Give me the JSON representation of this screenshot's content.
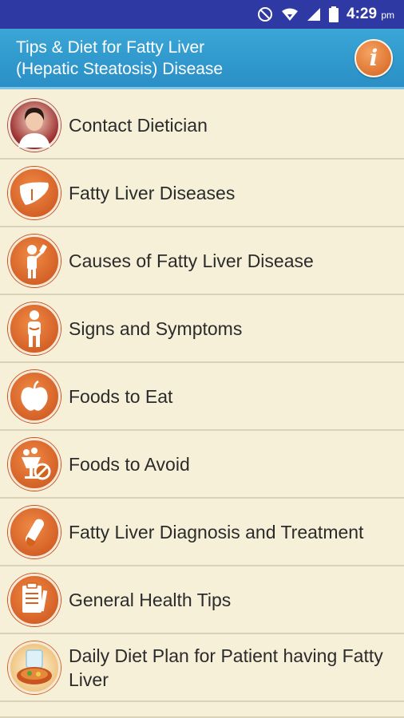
{
  "status_bar": {
    "time": "4:29",
    "ampm": "pm"
  },
  "app_bar": {
    "title": "Tips & Diet for Fatty Liver\n(Hepatic Steatosis) Disease",
    "info_icon": "info-icon"
  },
  "menu": [
    {
      "label": "Contact Dietician",
      "icon": "dietician-avatar"
    },
    {
      "label": "Fatty Liver Diseases",
      "icon": "liver-icon"
    },
    {
      "label": "Causes of Fatty Liver Disease",
      "icon": "drinking-person-icon"
    },
    {
      "label": "Signs and Symptoms",
      "icon": "stomach-pain-person-icon"
    },
    {
      "label": "Foods to Eat",
      "icon": "apple-icon"
    },
    {
      "label": "Foods to Avoid",
      "icon": "no-food-icon"
    },
    {
      "label": "Fatty Liver Diagnosis and Treatment",
      "icon": "test-tube-icon"
    },
    {
      "label": "General Health Tips",
      "icon": "clipboard-icon"
    },
    {
      "label": "Daily Diet Plan for Patient having Fatty Liver",
      "icon": "diet-meal-icon"
    }
  ],
  "colors": {
    "status_bar": "#2f39a3",
    "app_bar": "#2a8fc6",
    "background": "#f6f0d8",
    "icon_orange": "#d4611c"
  }
}
